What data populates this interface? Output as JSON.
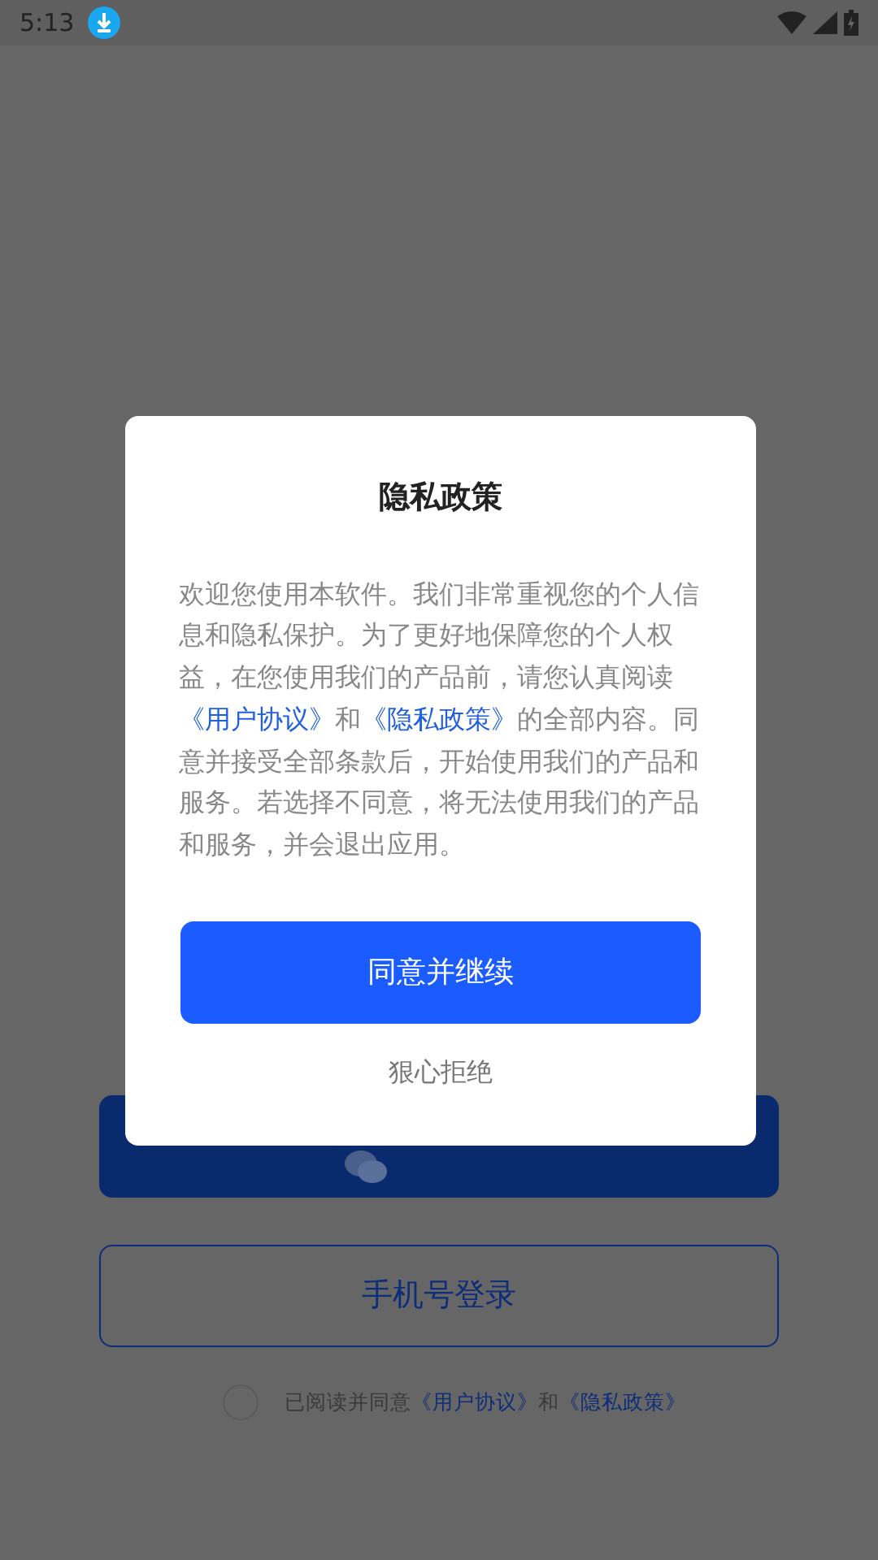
{
  "status_bar": {
    "time": "5:13"
  },
  "login": {
    "phone_button": "手机号登录",
    "agreement": {
      "checked": false,
      "segments": [
        {
          "kind": "plain",
          "text": "已阅读并同意"
        },
        {
          "kind": "link",
          "text": "《用户协议》"
        },
        {
          "kind": "plain",
          "text": "和"
        },
        {
          "kind": "link",
          "text": "《隐私政策》"
        }
      ]
    }
  },
  "dialog": {
    "title": "隐私政策",
    "body": [
      {
        "kind": "plain",
        "text": "欢迎您使用本软件。我们非常重视您的个人信息和隐私保护。为了更好地保障您的个人权益，在您使用我们的产品前，请您认真阅读"
      },
      {
        "kind": "link",
        "text": "《用户协议》"
      },
      {
        "kind": "plain",
        "text": "和"
      },
      {
        "kind": "link",
        "text": "《隐私政策》"
      },
      {
        "kind": "plain",
        "text": "的全部内容。同意并接受全部条款后，开始使用我们的产品和服务。若选择不同意，将无法使用我们的产品和服务，并会退出应用。"
      }
    ],
    "agree_button": "同意并继续",
    "refuse_button": "狠心拒绝"
  }
}
